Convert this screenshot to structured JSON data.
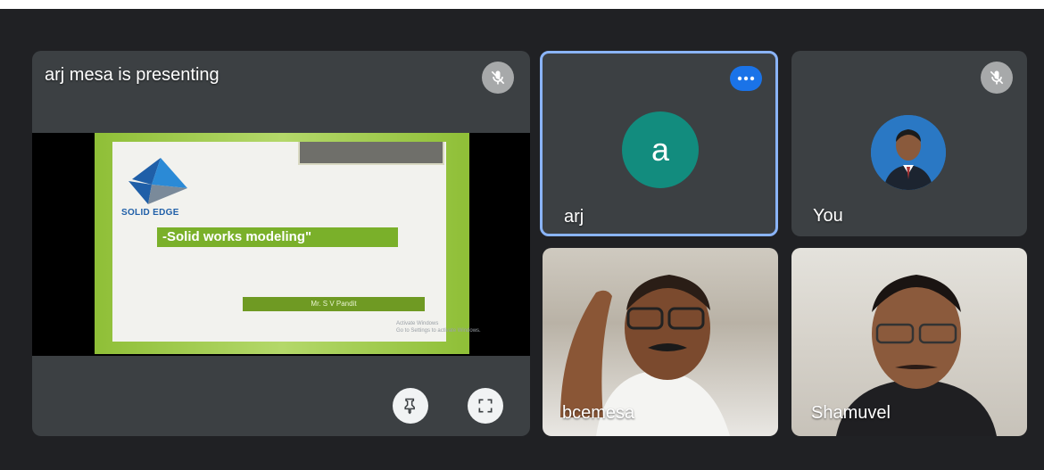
{
  "presentation": {
    "title": "arj mesa is presenting",
    "slide": {
      "logo": "SOLID EDGE",
      "title": "-Solid works modeling\"",
      "presenter": "Mr. S V Pandit",
      "watermark_line1": "Activate Windows",
      "watermark_line2": "Go to Settings to activate Windows."
    },
    "mic_icon": "mic-off-icon",
    "pin_icon": "pin-icon",
    "fullscreen_icon": "fullscreen-icon"
  },
  "participants": [
    {
      "name": "arj",
      "avatar_letter": "a",
      "avatar_color": "#128c7e",
      "highlighted": true,
      "more_icon": "more-horizontal-icon"
    },
    {
      "name": "You",
      "avatar": "profile-photo",
      "mic_icon": "mic-off-icon"
    },
    {
      "name": "bcemesa",
      "video": "camera-feed"
    },
    {
      "name": "Shamuvel",
      "video": "camera-feed"
    }
  ],
  "colors": {
    "background": "#202124",
    "tile": "#3c4043",
    "active_border": "#8ab4f8",
    "accent": "#1a73e8"
  }
}
